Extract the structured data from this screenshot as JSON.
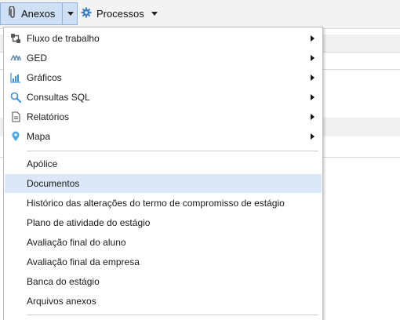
{
  "toolbar": {
    "anexos_label": "Anexos",
    "processos_label": "Processos"
  },
  "menu": {
    "submenus": [
      {
        "label": "Fluxo de trabalho",
        "icon": "workflow-icon"
      },
      {
        "label": "GED",
        "icon": "ged-icon"
      },
      {
        "label": "Gráficos",
        "icon": "chart-icon"
      },
      {
        "label": "Consultas SQL",
        "icon": "search-icon"
      },
      {
        "label": "Relatórios",
        "icon": "report-icon"
      },
      {
        "label": "Mapa",
        "icon": "map-pin-icon"
      }
    ],
    "items": [
      {
        "label": "Apólice"
      },
      {
        "label": "Documentos"
      },
      {
        "label": "Histórico das alterações do termo de compromisso de estágio"
      },
      {
        "label": "Plano de atividade do estágio"
      },
      {
        "label": "Avaliação final do aluno"
      },
      {
        "label": "Avaliação final da empresa"
      },
      {
        "label": "Banca do estágio"
      },
      {
        "label": "Arquivos anexos"
      }
    ],
    "highlighted_item": "Documentos"
  },
  "colors": {
    "accent_blue": "#3c8fd8",
    "highlight": "#dce8f8",
    "toolbar_active": "#cfe0f5"
  }
}
